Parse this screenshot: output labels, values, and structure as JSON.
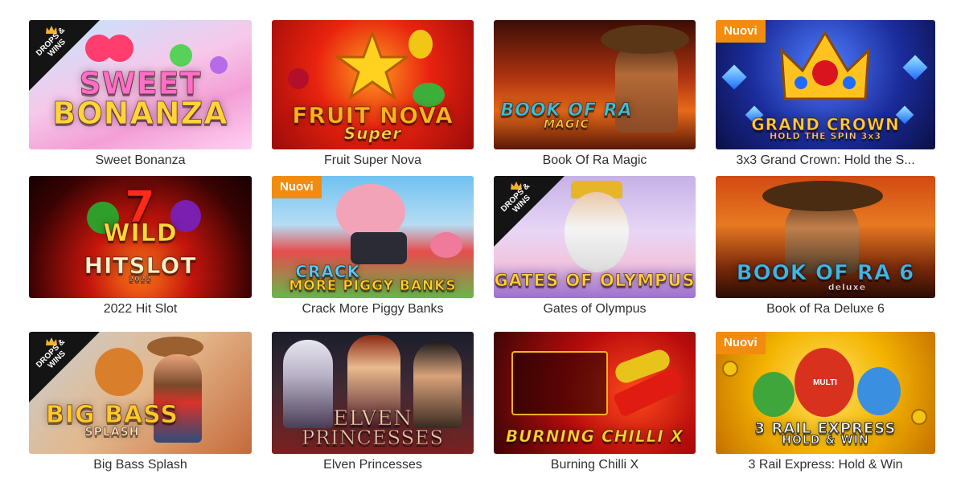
{
  "drops_wins_label": "DROPS & WINS",
  "games": [
    {
      "id": "sweet-bonanza",
      "title": "Sweet Bonanza",
      "logo_line1": "SWEET",
      "logo_line2": "BONANZA",
      "drops_wins": true,
      "badge": ""
    },
    {
      "id": "fruit-super-nova",
      "title": "Fruit Super Nova",
      "logo_line1": "FRUIT NOVA",
      "logo_line2": "Super",
      "drops_wins": false,
      "badge": ""
    },
    {
      "id": "book-of-ra-magic",
      "title": "Book Of Ra Magic",
      "logo_line1": "BOOK OF RA",
      "logo_line2": "MAGIC",
      "drops_wins": false,
      "badge": ""
    },
    {
      "id": "grand-crown",
      "title": "3x3 Grand Crown: Hold the S...",
      "logo_line1": "GRAND CROWN",
      "logo_line2": "HOLD THE SPIN 3x3",
      "drops_wins": false,
      "badge": "Nuovi"
    },
    {
      "id": "hit-slot-2022",
      "title": "2022 Hit Slot",
      "logo_line1": "WILD",
      "logo_line2": "HITSLOT",
      "logo_sub": "2022",
      "drops_wins": false,
      "badge": ""
    },
    {
      "id": "crack-more-piggy-banks",
      "title": "Crack More Piggy Banks",
      "logo_line1": "CRACK",
      "logo_line2": "MORE PIGGY BANKS",
      "drops_wins": false,
      "badge": "Nuovi"
    },
    {
      "id": "gates-of-olympus",
      "title": "Gates of Olympus",
      "logo_line1": "GATES OF OLYMPUS",
      "logo_line2": "",
      "drops_wins": true,
      "badge": ""
    },
    {
      "id": "book-of-ra-deluxe-6",
      "title": "Book of Ra Deluxe 6",
      "logo_line1": "BOOK OF RA 6",
      "logo_line2": "deluxe",
      "drops_wins": false,
      "badge": ""
    },
    {
      "id": "big-bass-splash",
      "title": "Big Bass Splash",
      "logo_line1": "BIG BASS",
      "logo_line2": "SPLASH",
      "drops_wins": true,
      "badge": ""
    },
    {
      "id": "elven-princesses",
      "title": "Elven Princesses",
      "logo_line1": "ELVEN",
      "logo_line2": "PRINCESSES",
      "drops_wins": false,
      "badge": ""
    },
    {
      "id": "burning-chilli-x",
      "title": "Burning Chilli X",
      "logo_line1": "BURNING CHILLI X",
      "logo_line2": "",
      "drops_wins": false,
      "badge": ""
    },
    {
      "id": "3-rail-express",
      "title": "3 Rail Express: Hold & Win",
      "logo_line1": "3 RAIL EXPRESS",
      "logo_line2": "HOLD & WIN",
      "logo_sub": "MULTI",
      "drops_wins": false,
      "badge": "Nuovi"
    }
  ],
  "colors": {
    "badge": "#f28c0f",
    "ribbon": "#141414",
    "title_text": "#303030"
  }
}
